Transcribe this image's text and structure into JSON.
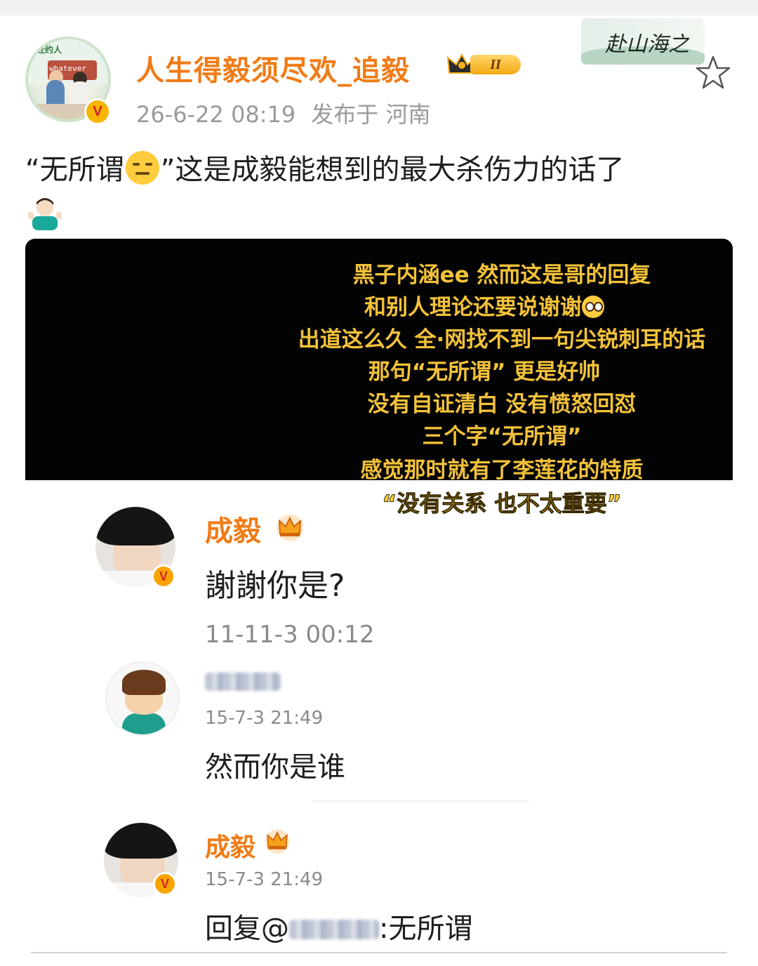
{
  "post": {
    "username": "人生得毅须尽欢_追毅",
    "vip_level": "II",
    "date": "26-6-22 08:19",
    "location": "发布于 河南",
    "seal_text": "赴山海之约",
    "text_part1": "“无所谓",
    "text_part2": "”这是成毅能想到的最大杀伤力的话了"
  },
  "embed": {
    "caption_lines": [
      "黑子内涵ee 然而这是哥的回复",
      "和别人理论还要说谢谢",
      "出道这么久 全·网找不到一句尖锐刺耳的话",
      "那句“无所谓” 更是好帅",
      "没有自证清白 没有愤怒回怼",
      "三个字“无所谓”",
      "感觉那时就有了李莲花的特质",
      "“没有关系 也不太重要”"
    ],
    "comments": [
      {
        "name": "成毅",
        "body": "謝謝你是?",
        "time": "11-11-3 00:12"
      },
      {
        "name": "",
        "time": "15-7-3 21:49",
        "body": "然而你是谁"
      },
      {
        "name": "成毅",
        "time": "15-7-3 21:49",
        "body_prefix": "回复@",
        "body_suffix": ":无所谓"
      }
    ]
  },
  "colors": {
    "accent": "#f07c17",
    "caption": "#f3c23a",
    "verified": "#f7b500"
  },
  "icons": [
    "star-icon",
    "crown-icon",
    "verified-icon",
    "expressionless-emoji-icon",
    "shrug-emoji-icon",
    "pleading-emoji-icon"
  ]
}
